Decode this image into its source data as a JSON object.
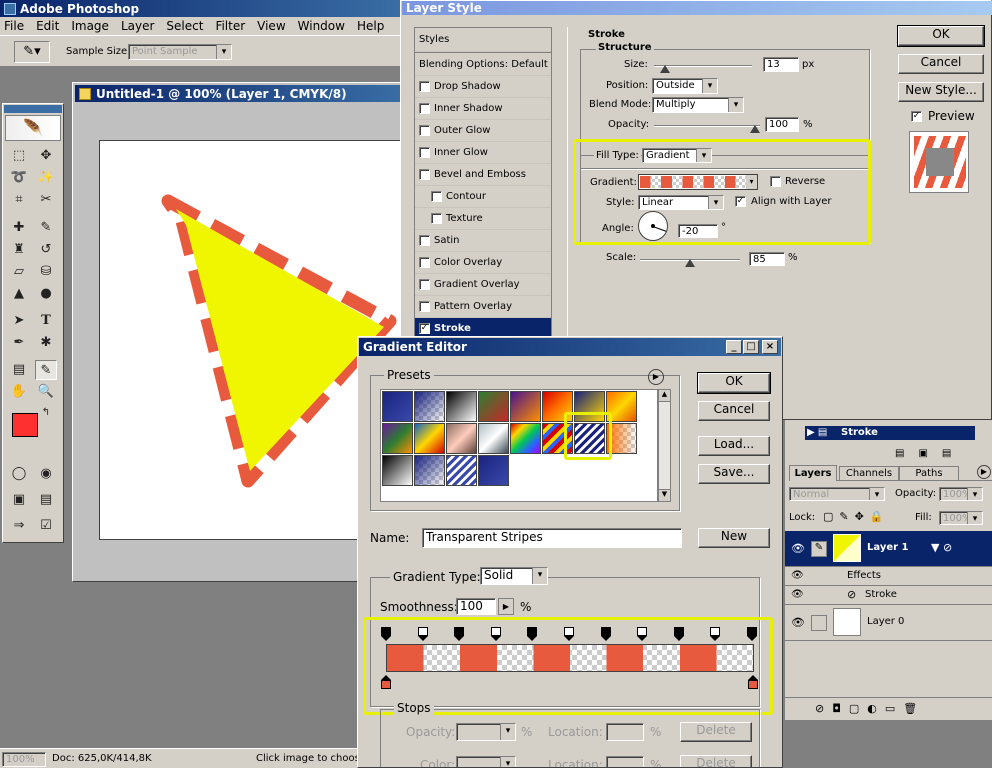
{
  "app": {
    "title": "Adobe Photoshop",
    "menu": [
      "File",
      "Edit",
      "Image",
      "Layer",
      "Select",
      "Filter",
      "View",
      "Window",
      "Help"
    ],
    "options": {
      "sample_size_label": "Sample Size:",
      "sample_size_value": "Point Sample"
    }
  },
  "document": {
    "title": "Untitled-1 @ 100% (Layer 1, CMYK/8)"
  },
  "colors": {
    "foreground": "#ff3030",
    "background": "#3a3aa0",
    "shape_fill": "#f0f500",
    "stroke": "#e85a3e",
    "highlight": "#e6f000",
    "selection": "#0a246a"
  },
  "status": {
    "zoom": "100%",
    "doc": "Doc: 625,0K/414,8K",
    "hint": "Click image to choose"
  },
  "layer_style": {
    "title": "Layer Style",
    "styles_header": "Styles",
    "blending_options": "Blending Options: Default",
    "items": [
      {
        "label": "Drop Shadow",
        "checked": false,
        "indent": false
      },
      {
        "label": "Inner Shadow",
        "checked": false,
        "indent": false
      },
      {
        "label": "Outer Glow",
        "checked": false,
        "indent": false
      },
      {
        "label": "Inner Glow",
        "checked": false,
        "indent": false
      },
      {
        "label": "Bevel and Emboss",
        "checked": false,
        "indent": false
      },
      {
        "label": "Contour",
        "checked": false,
        "indent": true
      },
      {
        "label": "Texture",
        "checked": false,
        "indent": true
      },
      {
        "label": "Satin",
        "checked": false,
        "indent": false
      },
      {
        "label": "Color Overlay",
        "checked": false,
        "indent": false
      },
      {
        "label": "Gradient Overlay",
        "checked": false,
        "indent": false
      },
      {
        "label": "Pattern Overlay",
        "checked": false,
        "indent": false
      },
      {
        "label": "Stroke",
        "checked": true,
        "indent": false
      }
    ],
    "section_title": "Stroke",
    "structure_title": "Structure",
    "size_label": "Size:",
    "size_value": "13",
    "size_unit": "px",
    "position_label": "Position:",
    "position_value": "Outside",
    "blend_mode_label": "Blend Mode:",
    "blend_mode_value": "Multiply",
    "opacity_label": "Opacity:",
    "opacity_value": "100",
    "opacity_unit": "%",
    "fill_type_label": "Fill Type:",
    "fill_type_value": "Gradient",
    "gradient_label": "Gradient:",
    "reverse_label": "Reverse",
    "style_label": "Style:",
    "style_value": "Linear",
    "align_label": "Align with Layer",
    "angle_label": "Angle:",
    "angle_value": "-20",
    "angle_unit": "°",
    "scale_label": "Scale:",
    "scale_value": "85",
    "scale_unit": "%",
    "ok": "OK",
    "cancel": "Cancel",
    "new_style": "New Style...",
    "preview": "Preview"
  },
  "gradient_editor": {
    "title": "Gradient Editor",
    "presets_label": "Presets",
    "ok": "OK",
    "cancel": "Cancel",
    "load": "Load...",
    "save": "Save...",
    "name_label": "Name:",
    "name_value": "Transparent Stripes",
    "new_button": "New",
    "gradient_type_label": "Gradient Type:",
    "gradient_type_value": "Solid",
    "smoothness_label": "Smoothness:",
    "smoothness_value": "100",
    "smoothness_unit": "%",
    "stops_label": "Stops",
    "opacity_label": "Opacity:",
    "location_label": "Location:",
    "color_label": "Color:",
    "percent": "%",
    "delete": "Delete"
  },
  "layers": {
    "effect_bar_label": "Stroke",
    "tabs": [
      "Layers",
      "Channels",
      "Paths"
    ],
    "blend_mode": "Normal",
    "opacity_label": "Opacity:",
    "opacity_value": "100%",
    "lock_label": "Lock:",
    "fill_label": "Fill:",
    "fill_value": "100%",
    "layer1": "Layer 1",
    "effects": "Effects",
    "stroke": "Stroke",
    "layer0": "Layer 0"
  }
}
